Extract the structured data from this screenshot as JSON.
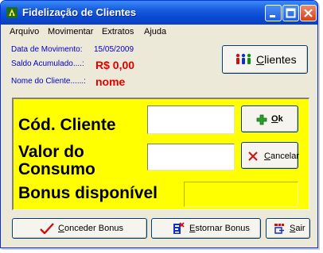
{
  "window": {
    "title": "Fidelização de Clientes"
  },
  "menu": {
    "items": [
      "Arquivo",
      "Movimentar",
      "Extratos",
      "Ajuda"
    ]
  },
  "info": {
    "movement_date_label": "Data de Movimento:",
    "movement_date_value": "15/05/2009",
    "balance_label": "Saldo Acumulado....:",
    "balance_value": "R$ 0,00",
    "client_name_label": "Nome do Cliente......:",
    "client_name_value": "nome"
  },
  "buttons": {
    "clients_prefix": "",
    "clients_accel": "C",
    "clients_rest": "lientes",
    "ok_accel": "O",
    "ok_rest": "k",
    "cancel_accel": "C",
    "cancel_rest": "ancelar",
    "grant_accel": "C",
    "grant_rest": "onceder Bonus",
    "reverse_accel": "E",
    "reverse_rest": "stornar Bonus",
    "exit_accel": "S",
    "exit_rest": "air"
  },
  "form": {
    "client_code_label": "Cód. Cliente",
    "client_code_value": "",
    "consumption_label_line1": "Valor do",
    "consumption_label_line2": "Consumo",
    "consumption_value": "",
    "bonus_label": "Bonus disponível",
    "bonus_value": ""
  },
  "colors": {
    "titlebar": "#0a49d2",
    "panel": "#ffff00",
    "info_label": "#0000c8",
    "info_value_blue": "#0000c8",
    "info_value_red": "#e00000"
  },
  "icons": {
    "app": "app-logo-icon",
    "clients": "people-icon",
    "ok": "green-plus-icon",
    "cancel": "red-x-icon",
    "grant": "red-check-icon",
    "reverse": "reverse-icon",
    "exit": "exit-icon"
  }
}
